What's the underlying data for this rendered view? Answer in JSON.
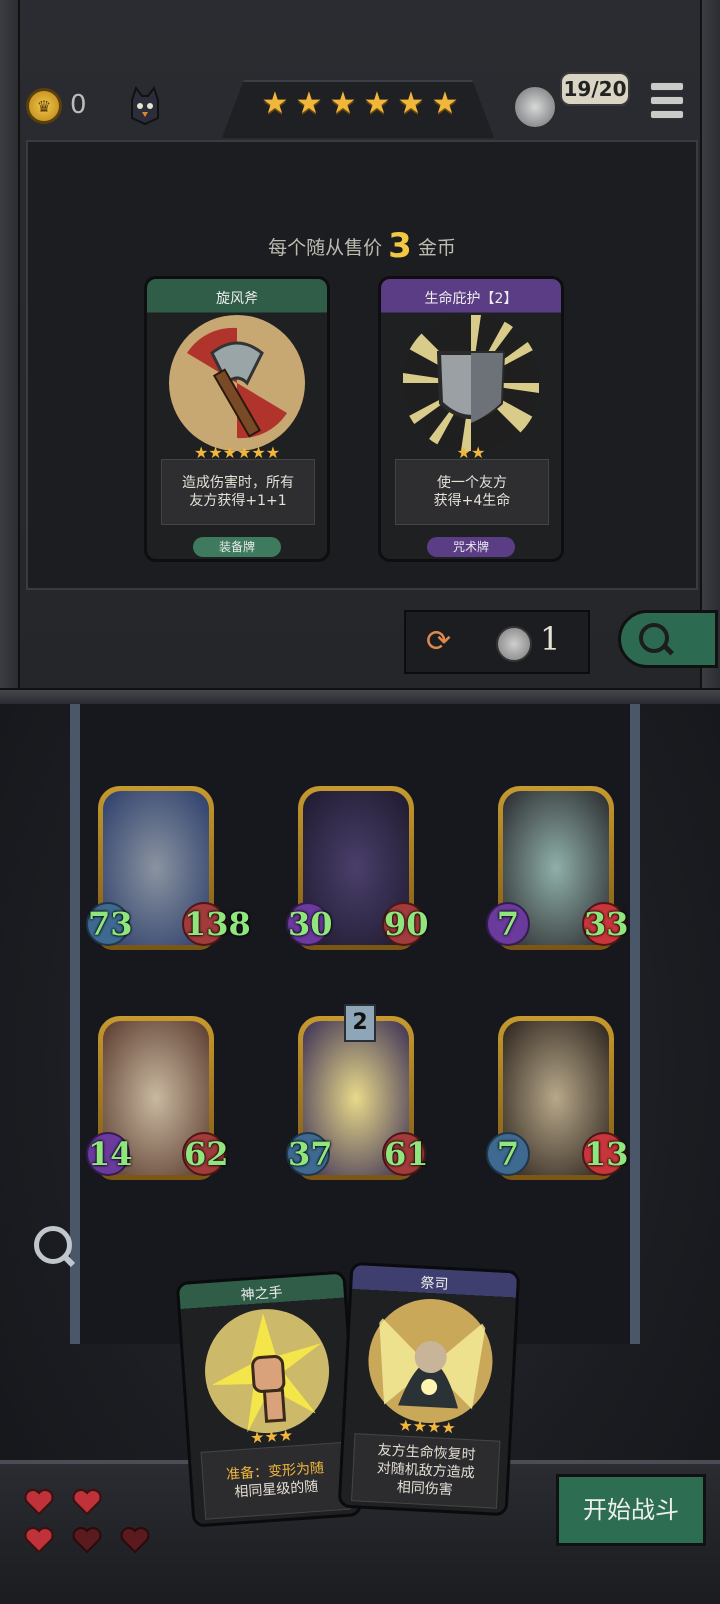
{
  "header": {
    "gold": "0",
    "stars": [
      "★",
      "★",
      "★",
      "★",
      "★",
      "★"
    ],
    "population": "19/20"
  },
  "shop": {
    "sell_prefix": "每个随从售价",
    "sell_price": "3",
    "sell_suffix": "金币",
    "cards": [
      {
        "title": "旋风斧",
        "stars": "★★★★★★",
        "desc_line1": "造成伤害时，所有",
        "desc_line2": "友方获得+1+1",
        "type": "装备牌"
      },
      {
        "title": "生命庇护【2】",
        "stars": "★★",
        "desc_line1": "使一个友方",
        "desc_line2": "获得+4生命",
        "type": "咒术牌"
      }
    ],
    "refresh_cost": "1"
  },
  "board": {
    "minions": [
      {
        "attack": "73",
        "health": "138"
      },
      {
        "attack": "30",
        "health": "90"
      },
      {
        "attack": "7",
        "health": "33"
      },
      {
        "attack": "14",
        "health": "62"
      },
      {
        "attack": "37",
        "health": "61",
        "tier": "2"
      },
      {
        "attack": "7",
        "health": "13"
      }
    ]
  },
  "hand": {
    "cards": [
      {
        "title": "神之手",
        "stars": "★★★",
        "desc_line1": "准备：变形为随",
        "desc_line2": "相同星级的随"
      },
      {
        "title": "祭司",
        "stars": "★★★★",
        "desc_line1": "友方生命恢复时",
        "desc_line2": "对随机敌方造成",
        "desc_line3": "相同伤害"
      }
    ]
  },
  "controls": {
    "start_battle": "开始战斗"
  },
  "colors": {
    "gold": "#f0b73a",
    "attack_green": "#8ee67c",
    "button_green": "#2d6d52",
    "heart_red": "#c0323a"
  }
}
